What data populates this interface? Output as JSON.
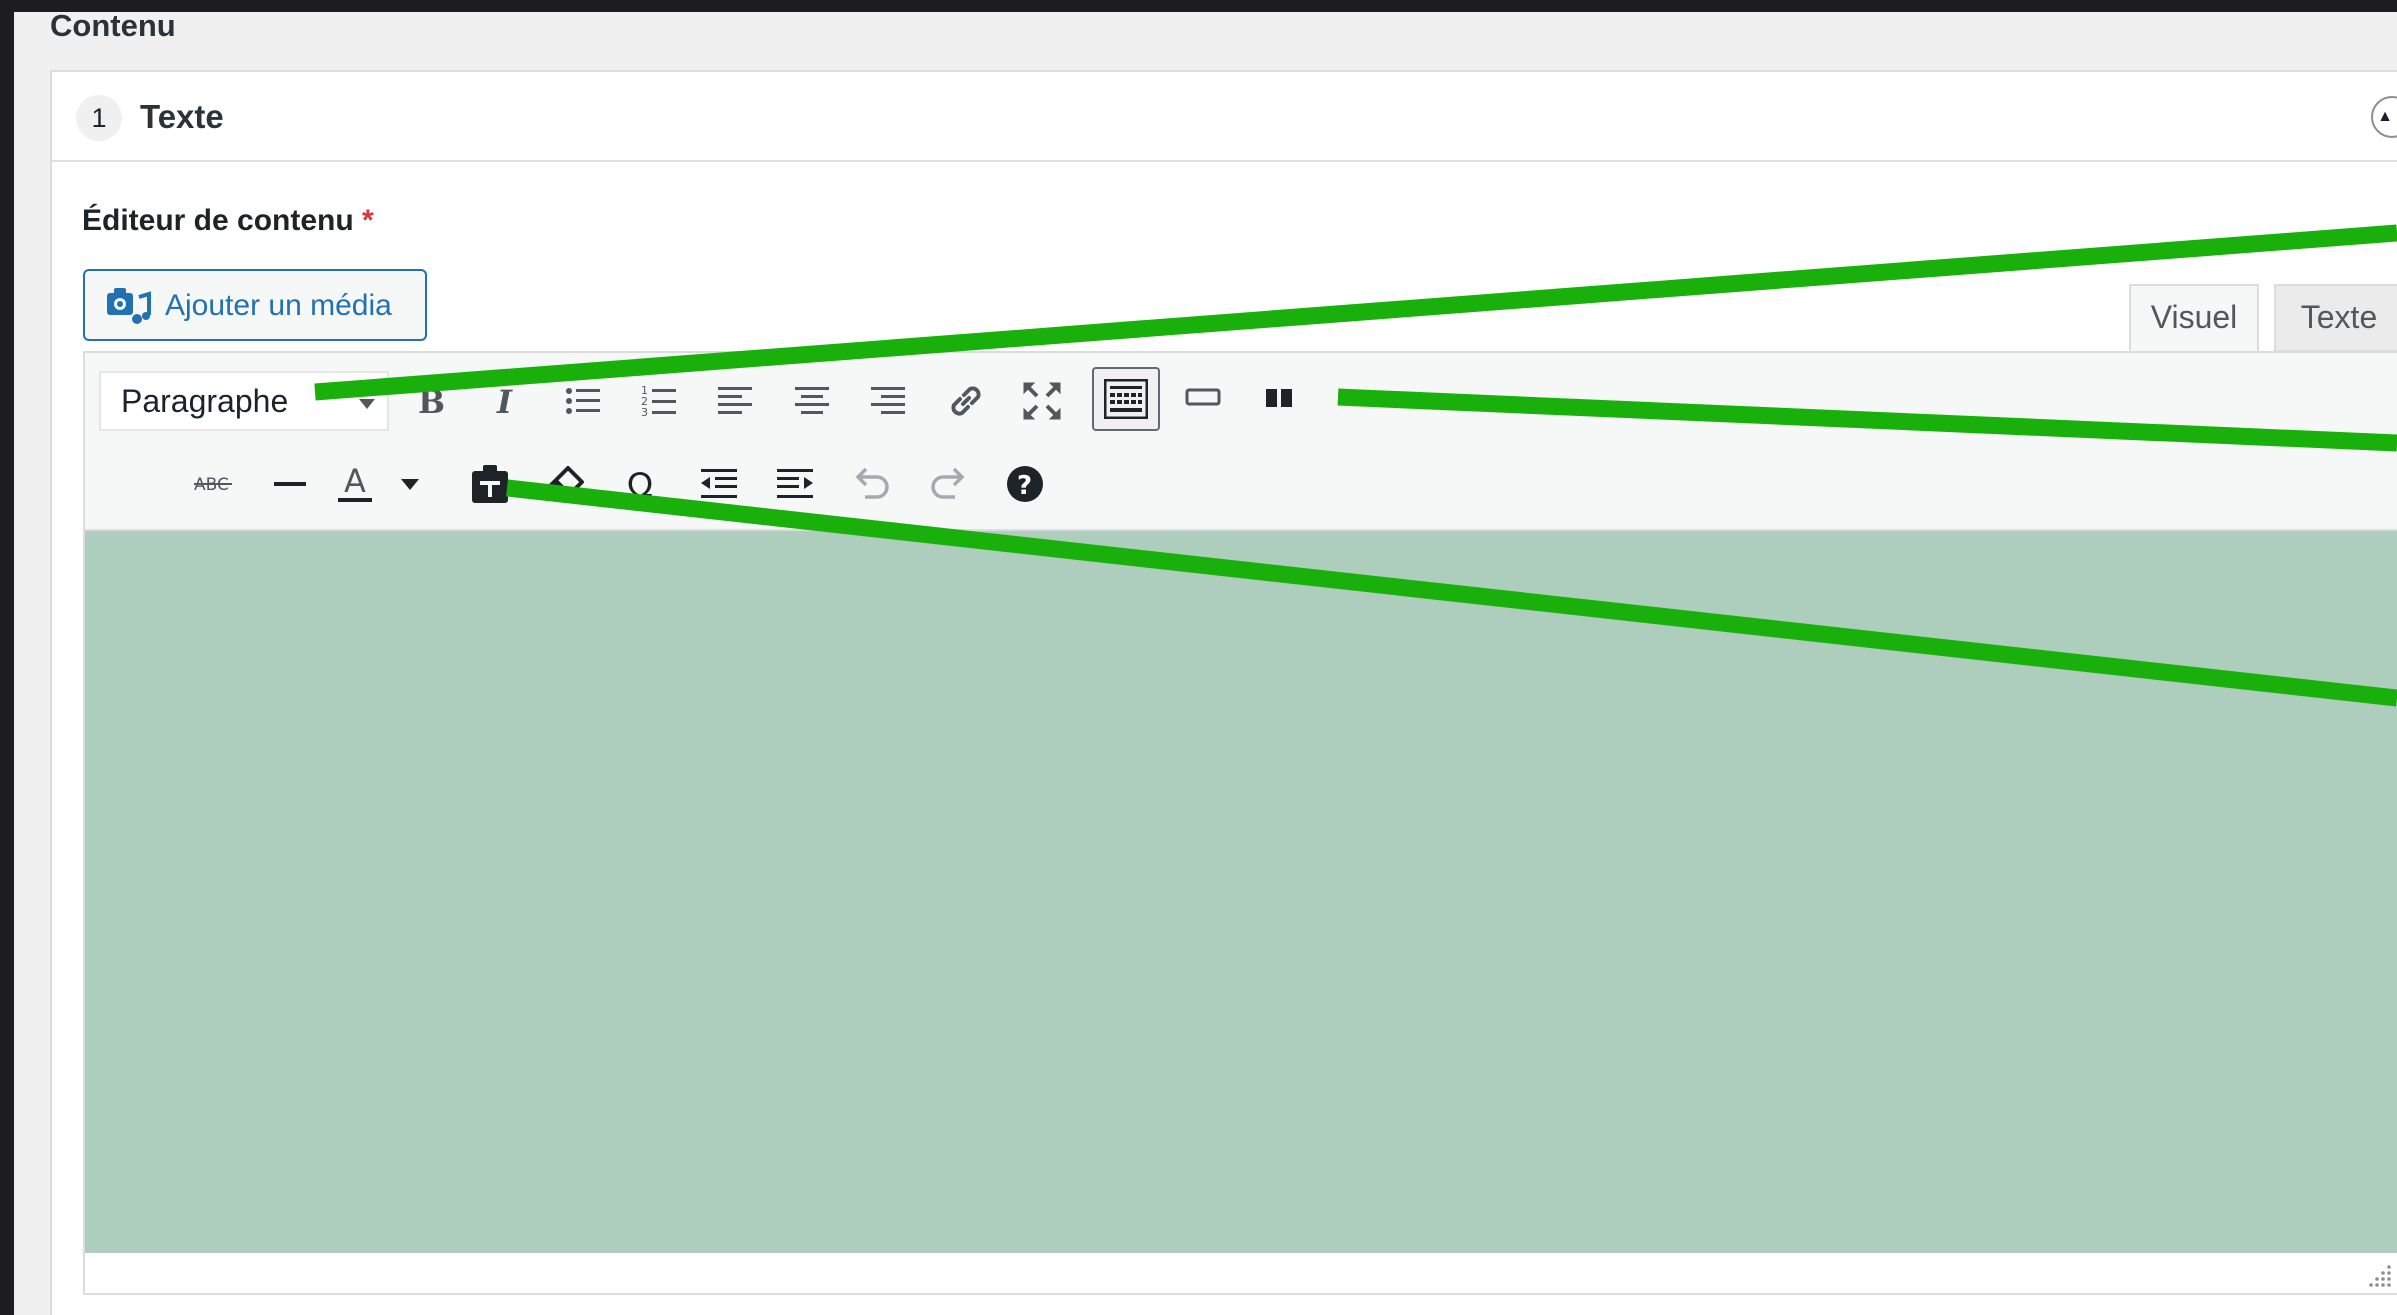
{
  "section_label": "Contenu",
  "layout": {
    "number": "1",
    "title": "Texte",
    "collapse_icon": "▲"
  },
  "field": {
    "label": "Éditeur de contenu",
    "required_mark": "*"
  },
  "media_button": {
    "label": "Ajouter un média"
  },
  "editor_tabs": {
    "visual": "Visuel",
    "text": "Texte"
  },
  "toolbar": {
    "format_select": "Paragraphe",
    "row1": [
      "bold-icon",
      "italic-icon",
      "bullet-list-icon",
      "numbered-list-icon",
      "align-left-icon",
      "align-center-icon",
      "align-right-icon",
      "link-icon",
      "fullscreen-icon",
      "toolbar-toggle-icon",
      "read-more-icon",
      "page-break-icon"
    ],
    "row2": [
      "strikethrough-icon",
      "horizontal-line-icon",
      "text-color-icon",
      "paste-as-text-icon",
      "clear-formatting-icon",
      "special-character-icon",
      "outdent-icon",
      "indent-icon",
      "undo-icon",
      "redo-icon",
      "help-icon"
    ],
    "strikethrough_glyph": "ABC",
    "text_color_glyph": "A",
    "special_char_glyph": "Ω",
    "help_glyph": "?"
  },
  "colors": {
    "editor_background": "#adcebd",
    "annotation_lines": "#19b00b",
    "link_blue": "#2271b1",
    "required_red": "#d63638"
  }
}
